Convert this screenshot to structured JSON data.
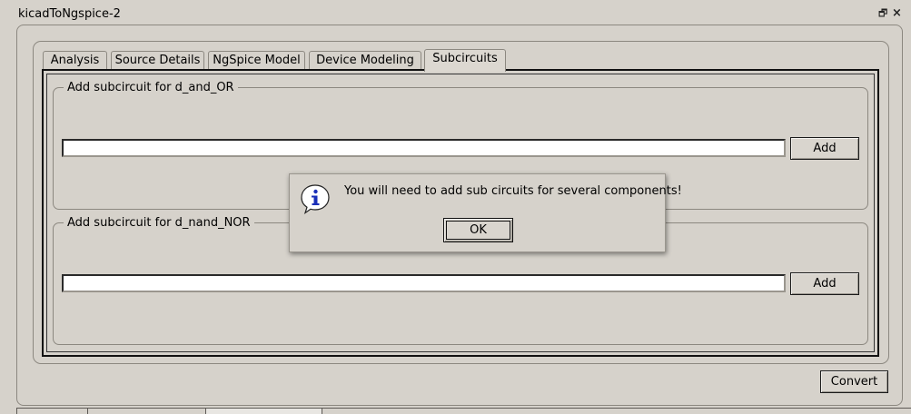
{
  "window": {
    "title": "kicadToNgspice-2",
    "restore_glyph": "🗗",
    "close_glyph": "×"
  },
  "tabs": [
    {
      "label": "Analysis",
      "active": false
    },
    {
      "label": "Source Details",
      "active": false
    },
    {
      "label": "NgSpice Model",
      "active": false
    },
    {
      "label": "Device Modeling",
      "active": false
    },
    {
      "label": "Subcircuits",
      "active": true
    }
  ],
  "subcircuits": [
    {
      "group_title": "Add subcircuit for d_and_OR",
      "input_value": "",
      "button_label": "Add"
    },
    {
      "group_title": "Add subcircuit for d_nand_NOR",
      "input_value": "",
      "button_label": "Add"
    }
  ],
  "footer": {
    "convert_label": "Convert"
  },
  "message_box": {
    "icon": "info-icon",
    "text": "You will need to add sub circuits for several components!",
    "ok_label": "OK"
  },
  "colors": {
    "window_bg": "#d6d2cb",
    "input_bg": "#ffffff",
    "info_icon_blue": "#1a2fb8"
  }
}
